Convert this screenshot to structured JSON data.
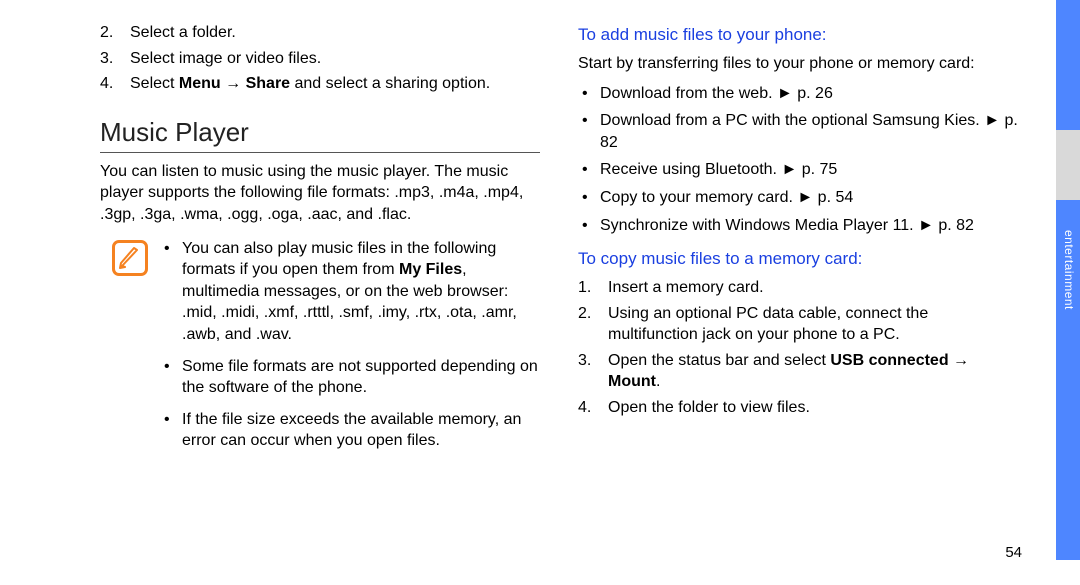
{
  "left": {
    "steps": [
      {
        "n": "2.",
        "text": "Select a folder."
      },
      {
        "n": "3.",
        "text": "Select image or video files."
      }
    ],
    "step4": {
      "n": "4."
    },
    "step4_pre": "Select ",
    "step4_bold1": "Menu",
    "step4_mid": " → ",
    "step4_bold2": "Share",
    "step4_post": " and select a sharing option.",
    "heading": "Music Player",
    "intro": "You can listen to music using the music player. The music player supports the following file formats: .mp3, .m4a, .mp4, .3gp, .3ga, .wma, .ogg, .oga, .aac, and .flac.",
    "note1_pre": "You can also play music files in the following formats if you open them from ",
    "note1_bold": "My Files",
    "note1_post": ", multimedia messages, or on the web browser: .mid, .midi, .xmf, .rtttl, .smf, .imy, .rtx, .ota, .amr, .awb, and .wav.",
    "note2": "Some file formats are not supported depending on the software of the phone.",
    "note3": "If the file size exceeds the available memory, an error can occur when you open files."
  },
  "right": {
    "h1": "To add music files to your phone:",
    "intro1": "Start by transferring files to your phone or memory card:",
    "bullets": [
      "Download from the web. ► p. 26",
      "Download from a PC with the optional Samsung Kies. ► p. 82",
      "Receive using Bluetooth. ► p. 75",
      "Copy to your memory card. ► p. 54",
      "Synchronize with Windows Media Player 11. ► p. 82"
    ],
    "h2": "To copy music files to a memory card:",
    "ol": [
      {
        "n": "1.",
        "text": "Insert a memory card."
      },
      {
        "n": "2.",
        "text": "Using an optional PC data cable, connect the multifunction jack on your phone to a PC."
      }
    ],
    "ol3": {
      "n": "3.",
      "pre": "Open the status bar and select ",
      "bold1": "USB connected",
      "mid": " → ",
      "bold2": "Mount",
      "post": "."
    },
    "ol4": {
      "n": "4.",
      "text": "Open the folder to view files."
    }
  },
  "side": "entertainment",
  "page": "54"
}
